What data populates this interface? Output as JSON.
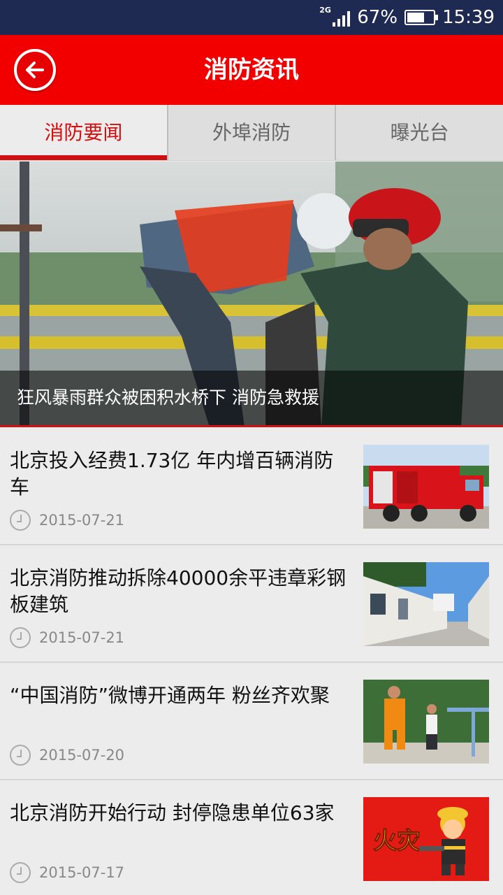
{
  "status_bar": {
    "network": "2G",
    "battery": "67%",
    "battery_level": 0.67,
    "time": "15:39"
  },
  "header": {
    "title": "消防资讯",
    "back_icon": "back-arrow-icon"
  },
  "tabs": [
    {
      "label": "消防要闻",
      "active": true
    },
    {
      "label": "外埠消防",
      "active": false
    },
    {
      "label": "曝光台",
      "active": false
    }
  ],
  "banner": {
    "caption": "狂风暴雨群众被困积水桥下 消防急救援"
  },
  "news": [
    {
      "title": "北京投入经费1.73亿 年内增百辆消防车",
      "date": "2015-07-21",
      "thumb": "fire-truck-image"
    },
    {
      "title": "北京消防推动拆除40000余平违章彩钢板建筑",
      "date": "2015-07-21",
      "thumb": "steel-buildings-image"
    },
    {
      "title": "“中国消防”微博开通两年 粉丝齐欢聚",
      "date": "2015-07-20",
      "thumb": "firefighter-mascot-image"
    },
    {
      "title": "北京消防开始行动 封停隐患单位63家",
      "date": "2015-07-17",
      "thumb": "fire-cartoon-image",
      "thumb_text": "火灾"
    }
  ],
  "colors": {
    "brand_red": "#f20000",
    "status_bar": "#1e2a52",
    "tab_active": "#d01010"
  }
}
